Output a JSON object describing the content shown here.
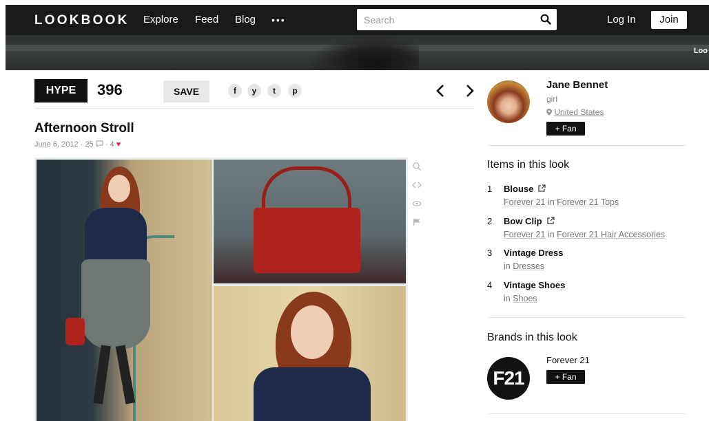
{
  "nav": {
    "logo": "LOOKBOOK",
    "explore": "Explore",
    "feed": "Feed",
    "blog": "Blog",
    "more": "•••",
    "search_placeholder": "Search",
    "login": "Log In",
    "join": "Join"
  },
  "banner": {
    "text": "Loo"
  },
  "actions": {
    "hype": "HYPE",
    "hype_count": "396",
    "save": "SAVE",
    "share": {
      "facebook": "f",
      "twitter": "y",
      "tumblr": "t",
      "pinterest": "p"
    },
    "prev": "‹",
    "next": "›"
  },
  "look": {
    "title": "Afternoon Stroll",
    "date": "June 6, 2012",
    "comments": "25",
    "hearts": "4"
  },
  "user": {
    "name": "Jane Bennet",
    "subtitle": "girl",
    "location": "United States",
    "fan_label": "+ Fan"
  },
  "items_section": {
    "title": "Items in this look",
    "items": [
      {
        "num": "1",
        "name": "Blouse",
        "prefix": "",
        "link1": "Forever 21",
        "mid": " in ",
        "link2": "Forever 21 Tops"
      },
      {
        "num": "2",
        "name": "Bow Clip",
        "prefix": "",
        "link1": "Forever 21",
        "mid": " in ",
        "link2": "Forever 21 Hair Accessories"
      },
      {
        "num": "3",
        "name": "Vintage Dress",
        "prefix": "in ",
        "link1": "Dresses",
        "mid": "",
        "link2": ""
      },
      {
        "num": "4",
        "name": "Vintage Shoes",
        "prefix": "in ",
        "link1": "Shoes",
        "mid": "",
        "link2": ""
      }
    ]
  },
  "brands_section": {
    "title": "Brands in this look",
    "brand_logo": "F21",
    "brand_name": "Forever 21",
    "fan_label": "+ Fan"
  },
  "colors": {
    "nav_bg": "#1a1a1a",
    "accent_heart": "#e0245e",
    "button_dark": "#111111"
  }
}
